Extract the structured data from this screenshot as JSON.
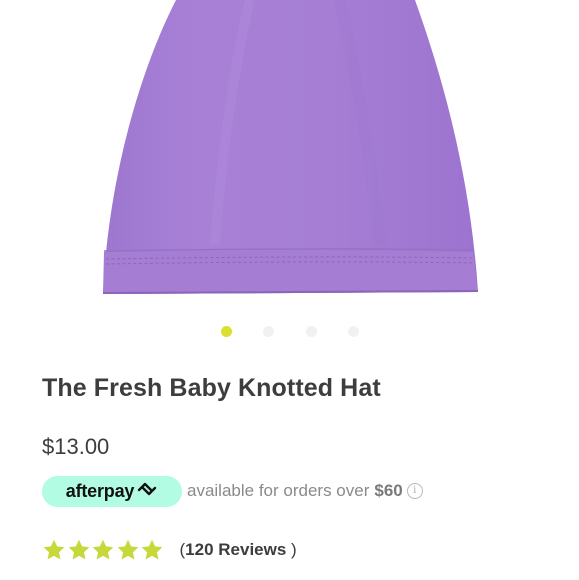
{
  "product": {
    "title": "The Fresh Baby Knotted Hat",
    "price": "$13.00",
    "image": {
      "icon": "purple-knotted-hat",
      "color": "#a67fd4"
    }
  },
  "carousel": {
    "dot_count": 4,
    "active_index": 0,
    "active_color": "#d9e12e",
    "inactive_color": "#f1f1f1"
  },
  "afterpay": {
    "logo_text": "afterpay",
    "logo_icon": "afterpay-arrows-icon",
    "badge_color": "#b2fce4",
    "text": "available for orders over",
    "amount": "$60",
    "info_icon": "info-icon"
  },
  "rating": {
    "stars": 5,
    "max_stars": 5,
    "star_color": "#c6d83a",
    "open_paren": "(",
    "count_label": "120 Reviews",
    "close_paren": " )"
  }
}
